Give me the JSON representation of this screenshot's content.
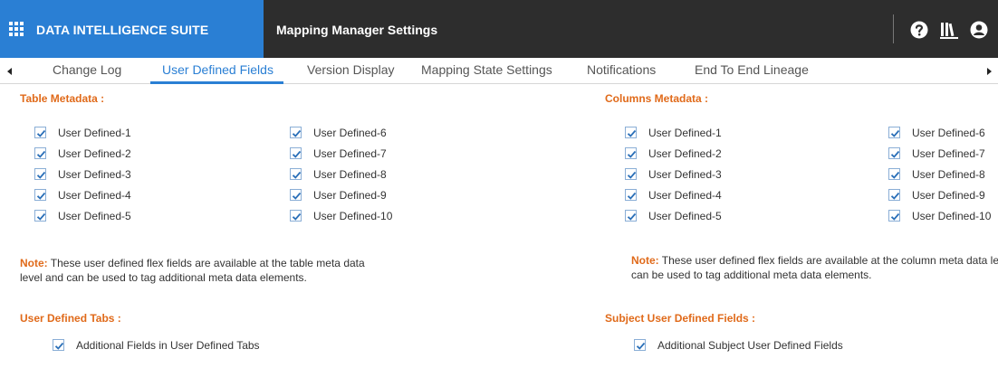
{
  "header": {
    "brand": "DATA INTELLIGENCE SUITE",
    "page_title": "Mapping Manager Settings",
    "icons": [
      "apps-grid-icon",
      "help-icon",
      "library-icon",
      "user-account-icon"
    ]
  },
  "tabs": [
    {
      "label": "Change Log",
      "active": false
    },
    {
      "label": "User Defined Fields",
      "active": true
    },
    {
      "label": "Version Display",
      "active": false
    },
    {
      "label": "Mapping State Settings",
      "active": false
    },
    {
      "label": "Notifications",
      "active": false
    },
    {
      "label": "End To End Lineage",
      "active": false
    }
  ],
  "table_metadata": {
    "title": "Table Metadata :",
    "fields": [
      {
        "label": "User Defined-1",
        "checked": true
      },
      {
        "label": "User Defined-2",
        "checked": true
      },
      {
        "label": "User Defined-3",
        "checked": true
      },
      {
        "label": "User Defined-4",
        "checked": true
      },
      {
        "label": "User Defined-5",
        "checked": true
      },
      {
        "label": "User Defined-6",
        "checked": true
      },
      {
        "label": "User Defined-7",
        "checked": true
      },
      {
        "label": "User Defined-8",
        "checked": true
      },
      {
        "label": "User Defined-9",
        "checked": true
      },
      {
        "label": "User Defined-10",
        "checked": true
      }
    ],
    "note_key": "Note:",
    "note_line1": " These user defined flex fields are available at the table meta data",
    "note_line2": "level and can be used to tag additional meta data elements."
  },
  "columns_metadata": {
    "title": "Columns Metadata :",
    "fields": [
      {
        "label": "User Defined-1",
        "checked": true
      },
      {
        "label": "User Defined-2",
        "checked": true
      },
      {
        "label": "User Defined-3",
        "checked": true
      },
      {
        "label": "User Defined-4",
        "checked": true
      },
      {
        "label": "User Defined-5",
        "checked": true
      },
      {
        "label": "User Defined-6",
        "checked": true
      },
      {
        "label": "User Defined-7",
        "checked": true
      },
      {
        "label": "User Defined-8",
        "checked": true
      },
      {
        "label": "User Defined-9",
        "checked": true
      },
      {
        "label": "User Defined-10",
        "checked": true
      }
    ],
    "note_key": "Note:",
    "note_line1": " These user defined flex fields are available at the column meta data leve",
    "note_line2": "can be used to tag additional meta data elements."
  },
  "user_defined_tabs": {
    "title": "User Defined Tabs :",
    "option": {
      "label": "Additional Fields in User Defined Tabs",
      "checked": true
    }
  },
  "subject_user_defined_fields": {
    "title": "Subject User Defined Fields :",
    "option": {
      "label": "Additional Subject User Defined Fields",
      "checked": true
    }
  }
}
